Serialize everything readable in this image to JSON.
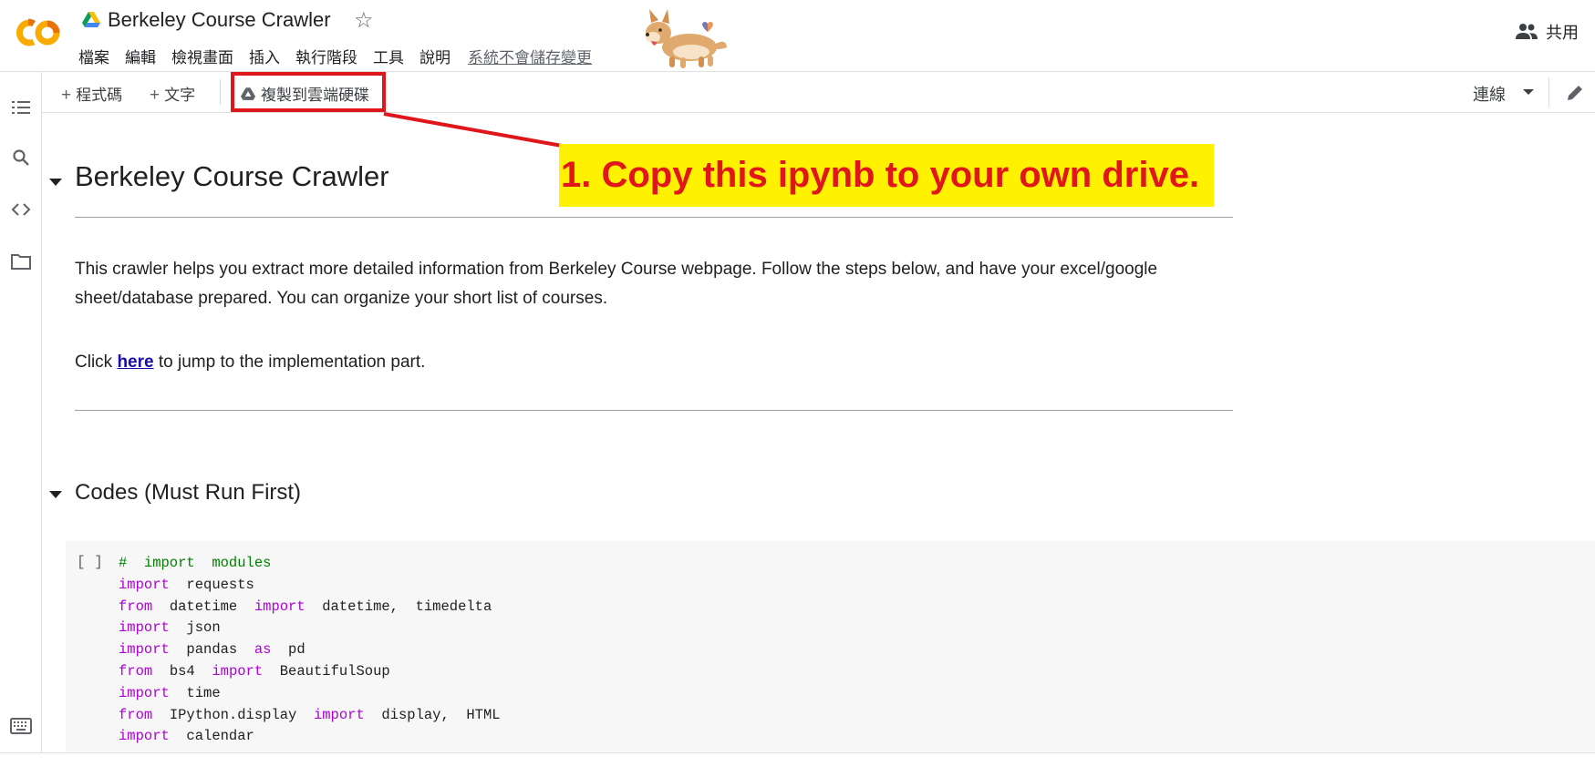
{
  "app": {
    "title": "Berkeley Course Crawler",
    "menu": [
      "檔案",
      "編輯",
      "檢視畫面",
      "插入",
      "執行階段",
      "工具",
      "說明"
    ],
    "unsaved_notice": "系統不會儲存變更",
    "share_label": "共用"
  },
  "toolbar": {
    "add_code": "程式碼",
    "add_text": "文字",
    "copy_to_drive": "複製到雲端硬碟",
    "connect": "連線"
  },
  "annotation": {
    "callout": "1. Copy this ipynb to your own drive.",
    "highlight_color": "#fff200",
    "text_color": "#e0161a"
  },
  "notebook": {
    "heading1": "Berkeley Course Crawler",
    "intro": "This crawler helps you extract more detailed information from Berkeley Course webpage. Follow the steps below, and have your excel/google sheet/database prepared. You can organize your short list of courses.",
    "click_prefix": "Click ",
    "click_link": "here",
    "click_suffix": " to jump to the implementation part.",
    "heading2": "Codes (Must Run First)",
    "cell_prompt": "[ ]",
    "code_lines": [
      [
        {
          "t": "#  import  modules",
          "c": "cm"
        }
      ],
      [
        {
          "t": "import",
          "c": "kw"
        },
        {
          "t": "  requests",
          "c": ""
        }
      ],
      [
        {
          "t": "from",
          "c": "kw"
        },
        {
          "t": "  datetime  ",
          "c": ""
        },
        {
          "t": "import",
          "c": "kw"
        },
        {
          "t": "  datetime,  timedelta",
          "c": ""
        }
      ],
      [
        {
          "t": "import",
          "c": "kw"
        },
        {
          "t": "  json",
          "c": ""
        }
      ],
      [
        {
          "t": "import",
          "c": "kw"
        },
        {
          "t": "  pandas  ",
          "c": ""
        },
        {
          "t": "as",
          "c": "kw"
        },
        {
          "t": "  pd",
          "c": ""
        }
      ],
      [
        {
          "t": "from",
          "c": "kw"
        },
        {
          "t": "  bs4  ",
          "c": ""
        },
        {
          "t": "import",
          "c": "kw"
        },
        {
          "t": "  BeautifulSoup",
          "c": ""
        }
      ],
      [
        {
          "t": "import",
          "c": "kw"
        },
        {
          "t": "  time",
          "c": ""
        }
      ],
      [
        {
          "t": "from",
          "c": "kw"
        },
        {
          "t": "  IPython.display  ",
          "c": ""
        },
        {
          "t": "import",
          "c": "kw"
        },
        {
          "t": "  display,  HTML",
          "c": ""
        }
      ],
      [
        {
          "t": "import",
          "c": "kw"
        },
        {
          "t": "  calendar",
          "c": ""
        }
      ]
    ]
  }
}
